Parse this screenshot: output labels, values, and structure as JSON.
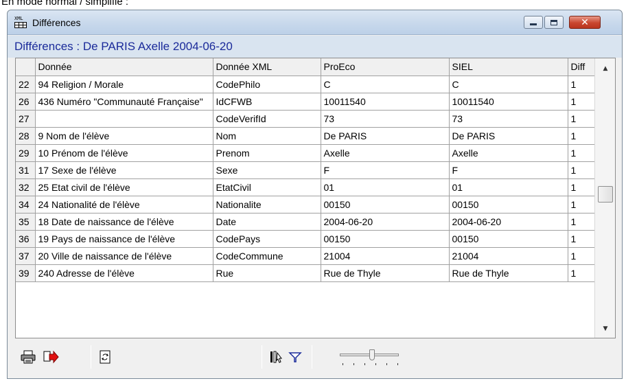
{
  "caption": "En mode normal / simplifié :",
  "window": {
    "title": "Différences",
    "icon_label": "XML"
  },
  "header": {
    "text": "Différences : De PARIS Axelle 2004-06-20"
  },
  "table": {
    "columns": [
      "",
      "Donnée",
      "Donnée XML",
      "ProEco",
      "SIEL",
      "Diff"
    ],
    "rows": [
      {
        "num": "22",
        "donnee": "94 Religion / Morale",
        "xml": "CodePhilo",
        "proeco": "C",
        "siel": "C",
        "diff": "1"
      },
      {
        "num": "26",
        "donnee": "436 Numéro \"Communauté Française\"",
        "xml": "IdCFWB",
        "proeco": "10011540",
        "siel": "10011540",
        "diff": "1"
      },
      {
        "num": "27",
        "donnee": "",
        "xml": "CodeVerifId",
        "proeco": "73",
        "siel": "73",
        "diff": "1"
      },
      {
        "num": "28",
        "donnee": "9 Nom de l'élève",
        "xml": "Nom",
        "proeco": "De PARIS",
        "siel": "De PARIS",
        "diff": "1"
      },
      {
        "num": "29",
        "donnee": "10 Prénom de l'élève",
        "xml": "Prenom",
        "proeco": "Axelle",
        "siel": "Axelle",
        "diff": "1"
      },
      {
        "num": "31",
        "donnee": "17 Sexe de l'élève",
        "xml": "Sexe",
        "proeco": "F",
        "siel": "F",
        "diff": "1"
      },
      {
        "num": "32",
        "donnee": "25 Etat civil de l'élève",
        "xml": "EtatCivil",
        "proeco": "01",
        "siel": "01",
        "diff": "1"
      },
      {
        "num": "34",
        "donnee": "24 Nationalité de l'élève",
        "xml": "Nationalite",
        "proeco": "00150",
        "siel": "00150",
        "diff": "1"
      },
      {
        "num": "35",
        "donnee": "18 Date de naissance de l'élève",
        "xml": "Date",
        "proeco": "2004-06-20",
        "siel": "2004-06-20",
        "diff": "1"
      },
      {
        "num": "36",
        "donnee": "19 Pays de naissance de l'élève",
        "xml": "CodePays",
        "proeco": "00150",
        "siel": "00150",
        "diff": "1"
      },
      {
        "num": "37",
        "donnee": "20 Ville de naissance de l'élève",
        "xml": "CodeCommune",
        "proeco": "21004",
        "siel": "21004",
        "diff": "1"
      },
      {
        "num": "39",
        "donnee": "240 Adresse de l'élève",
        "xml": "Rue",
        "proeco": "Rue de Thyle",
        "siel": "Rue de Thyle",
        "diff": "1"
      }
    ]
  },
  "toolbar": {
    "icons": [
      "printer-icon",
      "export-icon",
      "refresh-icon",
      "column-picker-icon",
      "filter-icon",
      "zoom-slider"
    ],
    "slider_level": 0.55
  },
  "colors": {
    "header_text": "#1a2a9a",
    "header_bg": "#d9e4f0",
    "close_button": "#c9462f"
  }
}
